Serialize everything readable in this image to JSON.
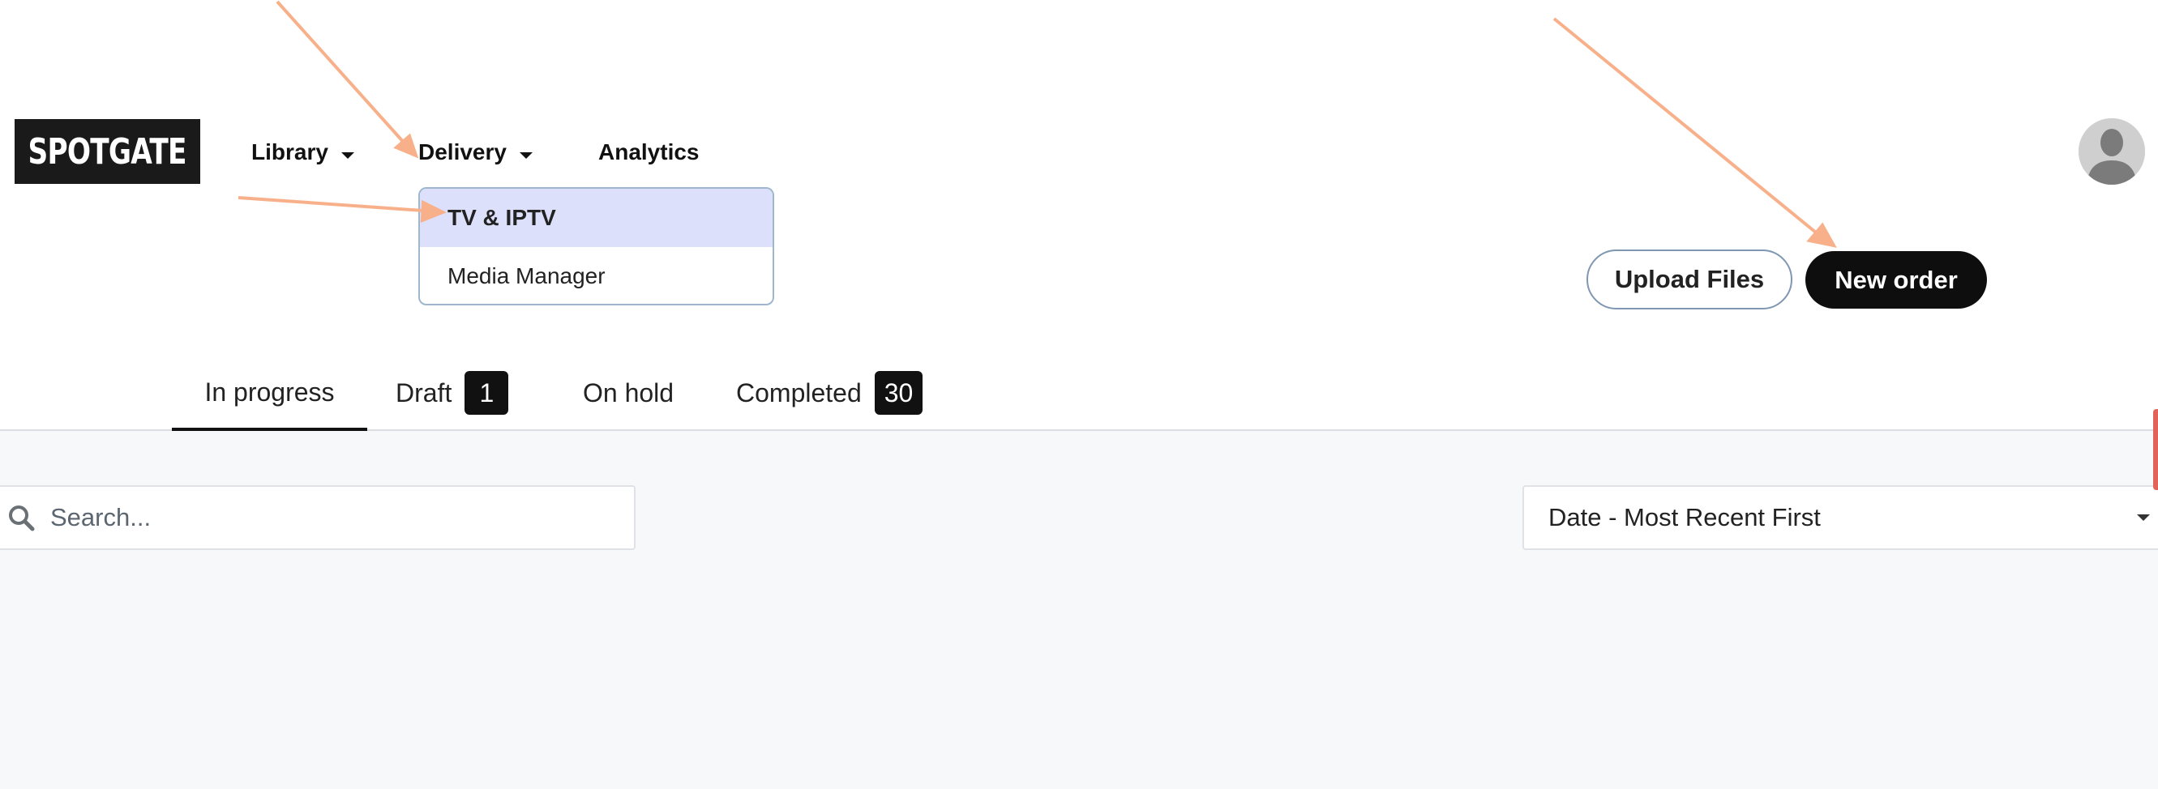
{
  "header": {
    "logo_text": "SPOTGATE",
    "nav": {
      "library": "Library",
      "delivery": "Delivery",
      "analytics": "Analytics"
    },
    "delivery_menu": [
      {
        "label": "TV & IPTV",
        "active": true
      },
      {
        "label": "Media Manager",
        "active": false
      }
    ],
    "avatar_icon": "user-avatar-icon"
  },
  "actions": {
    "upload_label": "Upload Files",
    "new_order_label": "New order"
  },
  "tabs": [
    {
      "label": "In progress",
      "count": null,
      "active": true
    },
    {
      "label": "Draft",
      "count": "1",
      "active": false
    },
    {
      "label": "On hold",
      "count": null,
      "active": false
    },
    {
      "label": "Completed",
      "count": "30",
      "active": false
    }
  ],
  "search": {
    "placeholder": "Search...",
    "value": "",
    "icon": "search-icon"
  },
  "sort": {
    "selected": "Date - Most Recent First"
  },
  "colors": {
    "annotation_arrow": "#f8b08a",
    "dropdown_highlight": "#dde0fb",
    "primary_button": "#0e0e0e",
    "edge_tab": "#e2625a"
  }
}
